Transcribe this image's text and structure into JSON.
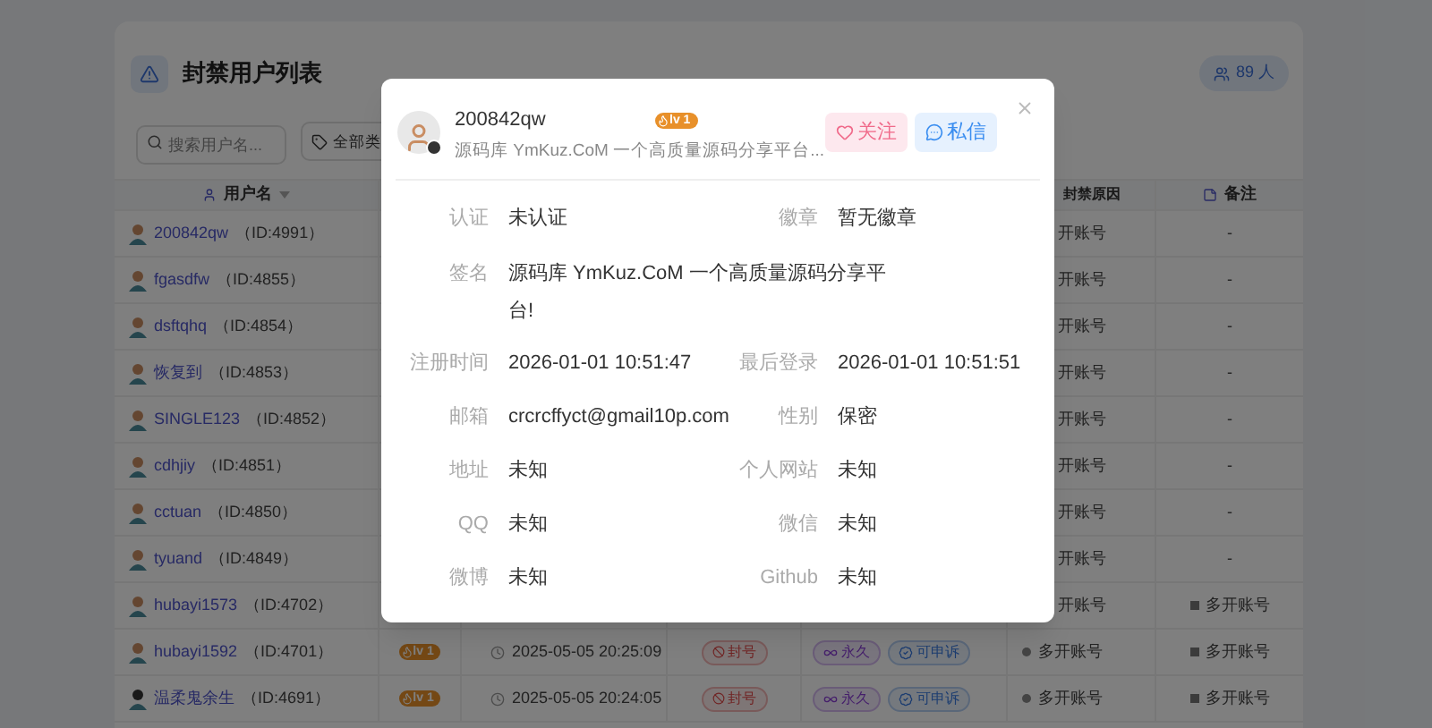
{
  "page": {
    "title": "封禁用户列表",
    "count": "89 人",
    "search": {
      "placeholder": "搜索用户名..."
    },
    "type_filter": "全部类",
    "columns": [
      "用户名",
      "封禁原因",
      "备注"
    ],
    "rows": [
      {
        "user": "200842qw",
        "id": "（ID:4991）",
        "reason": "开账号",
        "note": "-"
      },
      {
        "user": "fgasdfw",
        "id": "（ID:4855）",
        "reason": "开账号",
        "note": "-"
      },
      {
        "user": "dsftqhq",
        "id": "（ID:4854）",
        "reason": "开账号",
        "note": "-"
      },
      {
        "user": "恢复到",
        "id": "（ID:4853）",
        "reason": "开账号",
        "note": "-"
      },
      {
        "user": "SINGLE123",
        "id": "（ID:4852）",
        "reason": "开账号",
        "note": "-"
      },
      {
        "user": "cdhjiy",
        "id": "（ID:4851）",
        "reason": "开账号",
        "note": "-"
      },
      {
        "user": "cctuan",
        "id": "（ID:4850）",
        "reason": "开账号",
        "note": "-"
      },
      {
        "user": "tyuand",
        "id": "（ID:4849）",
        "reason": "开账号",
        "note": "-"
      },
      {
        "user": "hubayi1573",
        "id": "（ID:4702）",
        "reason": "开账号",
        "note": "多开账号"
      },
      {
        "user": "hubayi1592",
        "id": "（ID:4701）",
        "level": "lv 1",
        "time": "2025-05-05 20:25:09",
        "status": "封号",
        "duration": "永久",
        "appeal": "可申诉",
        "reason": "多开账号",
        "note": "多开账号"
      },
      {
        "user": "温柔鬼余生",
        "id": "（ID:4691）",
        "level": "lv 1",
        "time": "2025-05-05 20:24:05",
        "status": "封号",
        "duration": "永久",
        "appeal": "可申诉",
        "reason": "多开账号",
        "note": "多开账号"
      }
    ]
  },
  "modal": {
    "username": "200842qw",
    "level": "lv 1",
    "signature": "源码库 YmKuz.CoM 一个高质量源码分享平台...",
    "buttons": [
      {
        "kind": "follow",
        "label": "关注"
      },
      {
        "kind": "message",
        "label": "私信"
      }
    ],
    "fields": [
      {
        "kind": "half",
        "label": "认证",
        "value": "未认证"
      },
      {
        "kind": "half",
        "label": "徽章",
        "value": "暂无徽章"
      },
      {
        "kind": "full",
        "label": "签名",
        "value": "源码库 YmKuz.CoM 一个高质量源码分享平台!"
      },
      {
        "kind": "half",
        "label": "注册时间",
        "value": "2026-01-01 10:51:47"
      },
      {
        "kind": "half",
        "label": "最后登录",
        "value": "2026-01-01 10:51:51"
      },
      {
        "kind": "half",
        "label": "邮箱",
        "value": "crcrcffyct@gmail10p.com"
      },
      {
        "kind": "half",
        "label": "性别",
        "value": "保密"
      },
      {
        "kind": "half",
        "label": "地址",
        "value": "未知"
      },
      {
        "kind": "half",
        "label": "个人网站",
        "value": "未知"
      },
      {
        "kind": "half",
        "label": "QQ",
        "value": "未知"
      },
      {
        "kind": "half",
        "label": "微信",
        "value": "未知"
      },
      {
        "kind": "half",
        "label": "微博",
        "value": "未知"
      },
      {
        "kind": "half",
        "label": "Github",
        "value": "未知"
      }
    ]
  }
}
